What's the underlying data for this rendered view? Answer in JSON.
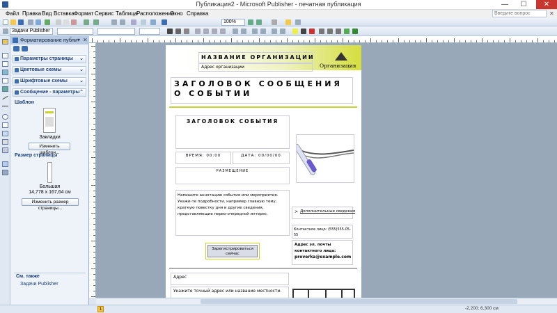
{
  "window": {
    "title": "Публикация2 - Microsoft Publisher - печатная публикация",
    "minimize": "—",
    "maximize": "☐",
    "close": "✕"
  },
  "menu": {
    "items": [
      "Файл",
      "Правка",
      "Вид",
      "Вставка",
      "Формат",
      "Сервис",
      "Таблица",
      "Расположение",
      "Окно",
      "Справка"
    ],
    "help_placeholder": "Введите вопрос"
  },
  "toolbar": {
    "zoom": "100%",
    "tasks_label": "Задачи Publisher"
  },
  "taskpane": {
    "title": "Форматирование публи",
    "sections": [
      "Параметры страницы",
      "Цветовые схемы",
      "Шрифтовые схемы",
      "Сообщение - параметры"
    ],
    "template_heading": "Шаблон",
    "template_name": "Закладки",
    "change_template_button": "Изменить шаблон...",
    "page_size_heading": "Размер страницы",
    "page_size_name": "Большая",
    "page_size_dims": "14,778 x 167,64 см",
    "change_size_button": "Изменить размер страницы...",
    "see_also_heading": "См. также",
    "see_also_link": "Задачи Publisher"
  },
  "document": {
    "org_name": "НАЗВАНИЕ ОРГАНИЗАЦИИ",
    "org_address": "Адрес организации",
    "logo_text": "Организация",
    "headline": "ЗАГОЛОВОК СООБЩЕНИЯ О СОБЫТИИ",
    "event_title": "ЗАГОЛОВОК СОБЫТИЯ",
    "time": "ВРЕМЯ: 00:00",
    "date": "ДАТА: 00/00/00",
    "location": "РАЗМЕЩЕНИЕ",
    "description": "Напишите аннотацию события или мероприятия. Укажи-те подробности, например главную тему, краткую повестку дня и другие сведения, представляющие перво-очередной интерес.",
    "more_info": "Дополнительные сведения",
    "contact": "Контактное лицо: (555)555-05-55",
    "email_label": "Адрес эл. почты контактного лица:",
    "email": "proverka@example.com",
    "register_button": "Зарегистрироваться сейчас",
    "address_label": "Адрес",
    "address_hint": "Укажите точный адрес или название местности."
  },
  "status": {
    "page_number": "1",
    "coordinates": "-2,200; 6,300 см"
  },
  "colors": {
    "accent": "#c8d42a",
    "titlebar_close": "#c7372f",
    "taskpane": "#eef3fa",
    "canvas": "#98a8b8"
  }
}
